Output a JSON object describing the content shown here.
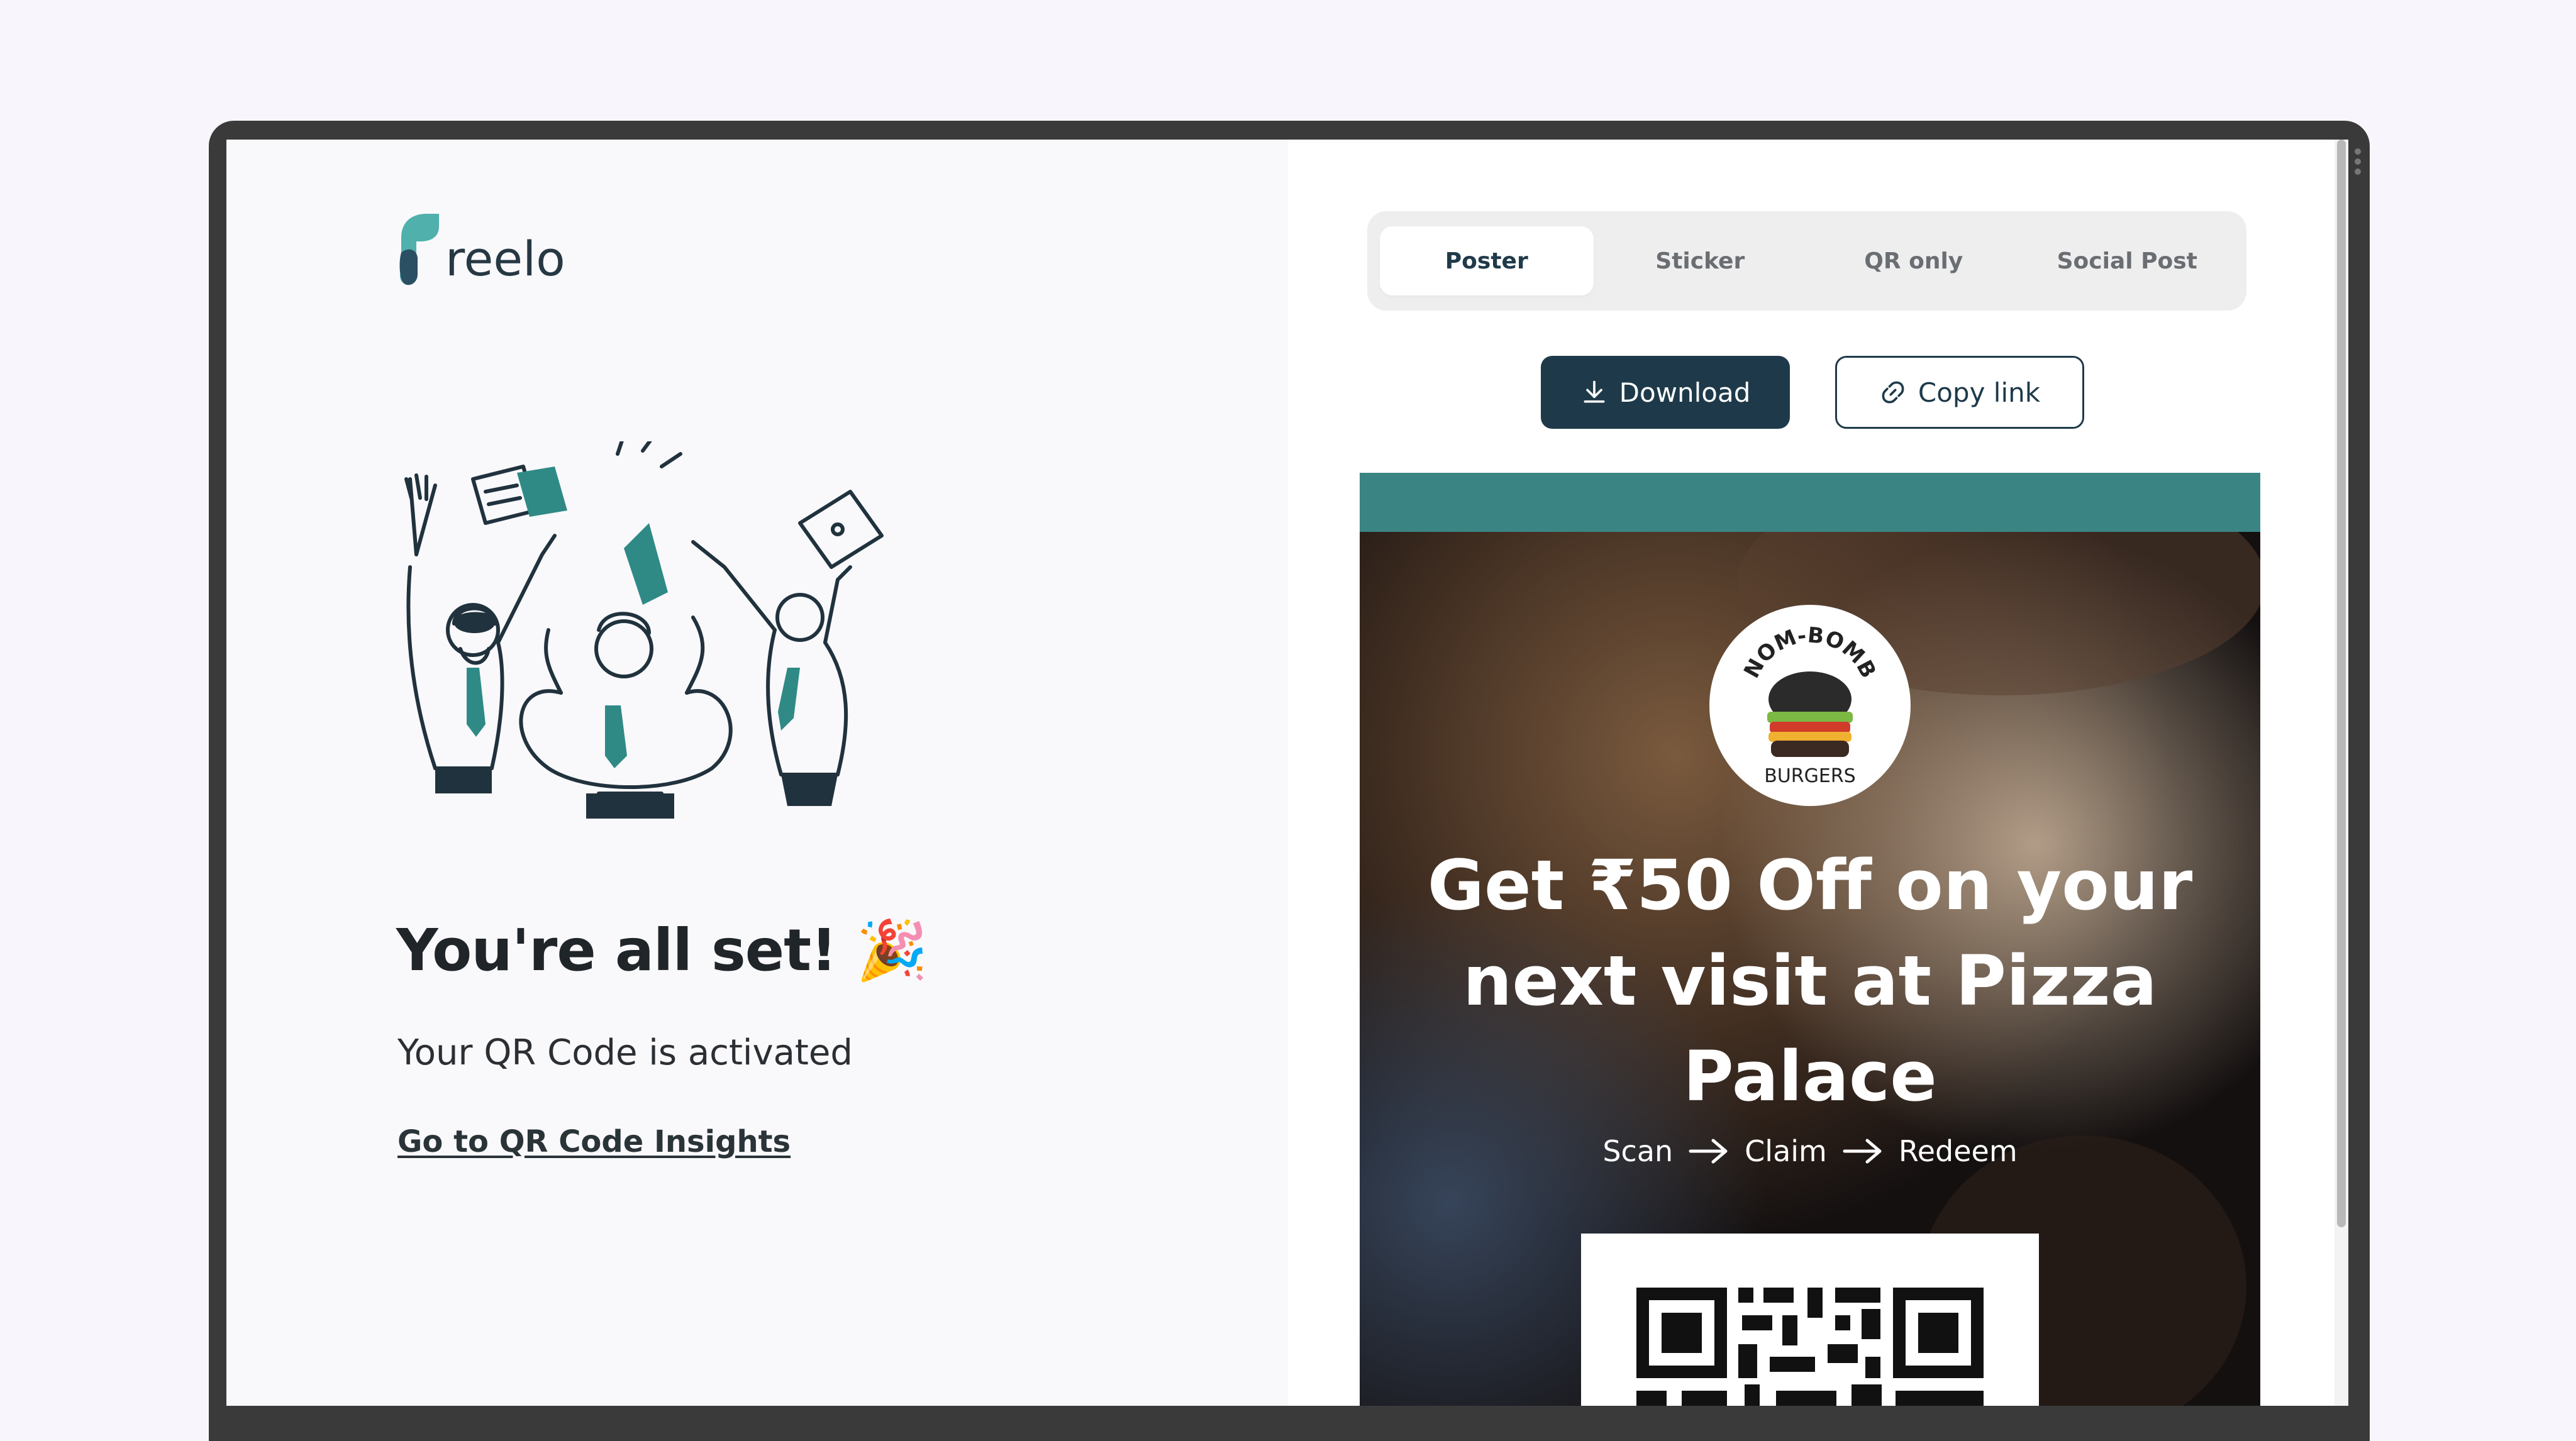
{
  "brand": {
    "logo_text": "reelo",
    "accent": "#4fb0ac",
    "dark": "#1e3a4a"
  },
  "success": {
    "title": "You're all set!",
    "emoji": "🎉",
    "subtitle": "Your QR Code is activated",
    "insights_link": "Go to QR Code Insights"
  },
  "tabs": [
    {
      "label": "Poster",
      "active": true
    },
    {
      "label": "Sticker",
      "active": false
    },
    {
      "label": "QR only",
      "active": false
    },
    {
      "label": "Social Post",
      "active": false
    }
  ],
  "actions": {
    "download_label": "Download",
    "copy_label": "Copy link"
  },
  "poster": {
    "badge_top": "NOM-BOMB",
    "badge_bottom": "BURGERS",
    "headline_lines": [
      "Get ₹50 Off on your",
      "next visit at Pizza",
      "Palace"
    ],
    "steps": [
      "Scan",
      "Claim",
      "Redeem"
    ],
    "band_color": "#3a8584"
  }
}
